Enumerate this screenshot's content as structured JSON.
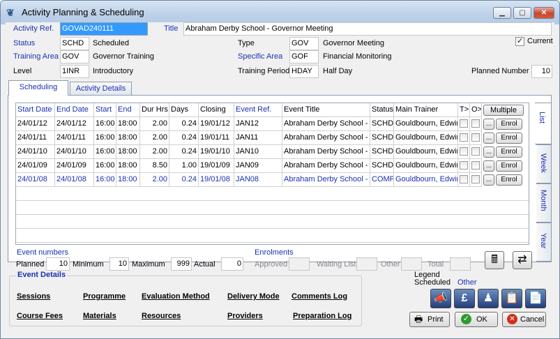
{
  "window": {
    "title": "Activity Planning & Scheduling",
    "minimize": "▁",
    "maximize": "▢",
    "close": "✕"
  },
  "form": {
    "activity_ref_label": "Activity Ref.",
    "activity_ref": "GOVAD240111",
    "title_label": "Title",
    "title": "Abraham Derby School - Governor Meeting",
    "status_label": "Status",
    "status_code": "SCHD",
    "status_desc": "Scheduled",
    "type_label": "Type",
    "type_code": "GOV",
    "type_desc": "Governor Meeting",
    "current_label": "Current",
    "current_checked": "✓",
    "training_area_label": "Training Area",
    "training_area_code": "GOV",
    "training_area_desc": "Governor Training",
    "specific_area_label": "Specific Area",
    "specific_area_code": "GOF",
    "specific_area_desc": "Financial Monitoring",
    "level_label": "Level",
    "level_code": "1INR",
    "level_desc": "Introductory",
    "training_period_label": "Training Period",
    "training_period_code": "HDAY",
    "training_period_desc": "Half Day",
    "planned_number_label": "Planned Number",
    "planned_number": "10"
  },
  "tabs": {
    "scheduling": "Scheduling",
    "details": "Activity Details"
  },
  "vtabs": {
    "list": "List",
    "week": "Week",
    "month": "Month",
    "year": "Year"
  },
  "grid": {
    "headers": [
      "Start Date",
      "End Date",
      "Start",
      "End",
      "Dur Hrs",
      "Days",
      "Closing",
      "Event Ref.",
      "Event Title",
      "Status",
      "Main Trainer",
      "T>",
      "O>"
    ],
    "multiple_label": "Multiple",
    "dots_label": "...",
    "enrol_label": "Enrol",
    "rows": [
      {
        "start_date": "24/01/12",
        "end_date": "24/01/12",
        "start": "16:00",
        "end": "18:00",
        "dur": "2.00",
        "days": "0.24",
        "closing": "19/01/12",
        "ref": "JAN12",
        "title": "Abraham Derby School - G",
        "status": "SCHD",
        "trainer": "Gouldbourn, Edwir"
      },
      {
        "start_date": "24/01/11",
        "end_date": "24/01/11",
        "start": "16:00",
        "end": "18:00",
        "dur": "2.00",
        "days": "0.24",
        "closing": "19/01/11",
        "ref": "JAN11",
        "title": "Abraham Derby School - G",
        "status": "SCHD",
        "trainer": "Gouldbourn, Edwir"
      },
      {
        "start_date": "24/01/10",
        "end_date": "24/01/10",
        "start": "16:00",
        "end": "18:00",
        "dur": "2.00",
        "days": "0.24",
        "closing": "19/01/10",
        "ref": "JAN10",
        "title": "Abraham Derby School - G",
        "status": "SCHD",
        "trainer": "Gouldbourn, Edwir"
      },
      {
        "start_date": "24/01/09",
        "end_date": "24/01/09",
        "start": "16:00",
        "end": "18:00",
        "dur": "8.50",
        "days": "1.00",
        "closing": "19/01/09",
        "ref": "JAN09",
        "title": "Abraham Derby School - G",
        "status": "SCHD",
        "trainer": "Gouldbourn, Edwir"
      },
      {
        "start_date": "24/01/08",
        "end_date": "24/01/08",
        "start": "16:00",
        "end": "18:00",
        "dur": "2.00",
        "days": "0.24",
        "closing": "19/01/08",
        "ref": "JAN08",
        "title": "Abraham Derby School - G",
        "status": "COMP",
        "trainer": "Gouldbourn, Edwir"
      }
    ]
  },
  "event_numbers": {
    "title": "Event numbers",
    "planned_label": "Planned",
    "planned": "10",
    "minimum_label": "Minimum",
    "minimum": "10",
    "maximum_label": "Maximum",
    "maximum": "999",
    "actual_label": "Actual",
    "actual": "0"
  },
  "enrolments": {
    "title": "Enrolments",
    "approved_label": "Approved",
    "waiting_label": "Waiting List",
    "other_label": "Other",
    "total_label": "Total"
  },
  "event_details": {
    "title": "Event Details",
    "links": [
      "Sessions",
      "Programme",
      "Evaluation Method",
      "Delivery Mode",
      "Comments Log",
      "Course Fees",
      "Materials",
      "Resources",
      "Providers",
      "Preparation Log"
    ]
  },
  "legend": {
    "title": "Legend",
    "scheduled": "Scheduled",
    "other": "Other"
  },
  "buttons": {
    "print": "Print",
    "ok": "OK",
    "cancel": "Cancel"
  },
  "colors": {
    "accent_blue": "#1a30b4",
    "completed_row": "#1a30b4"
  }
}
